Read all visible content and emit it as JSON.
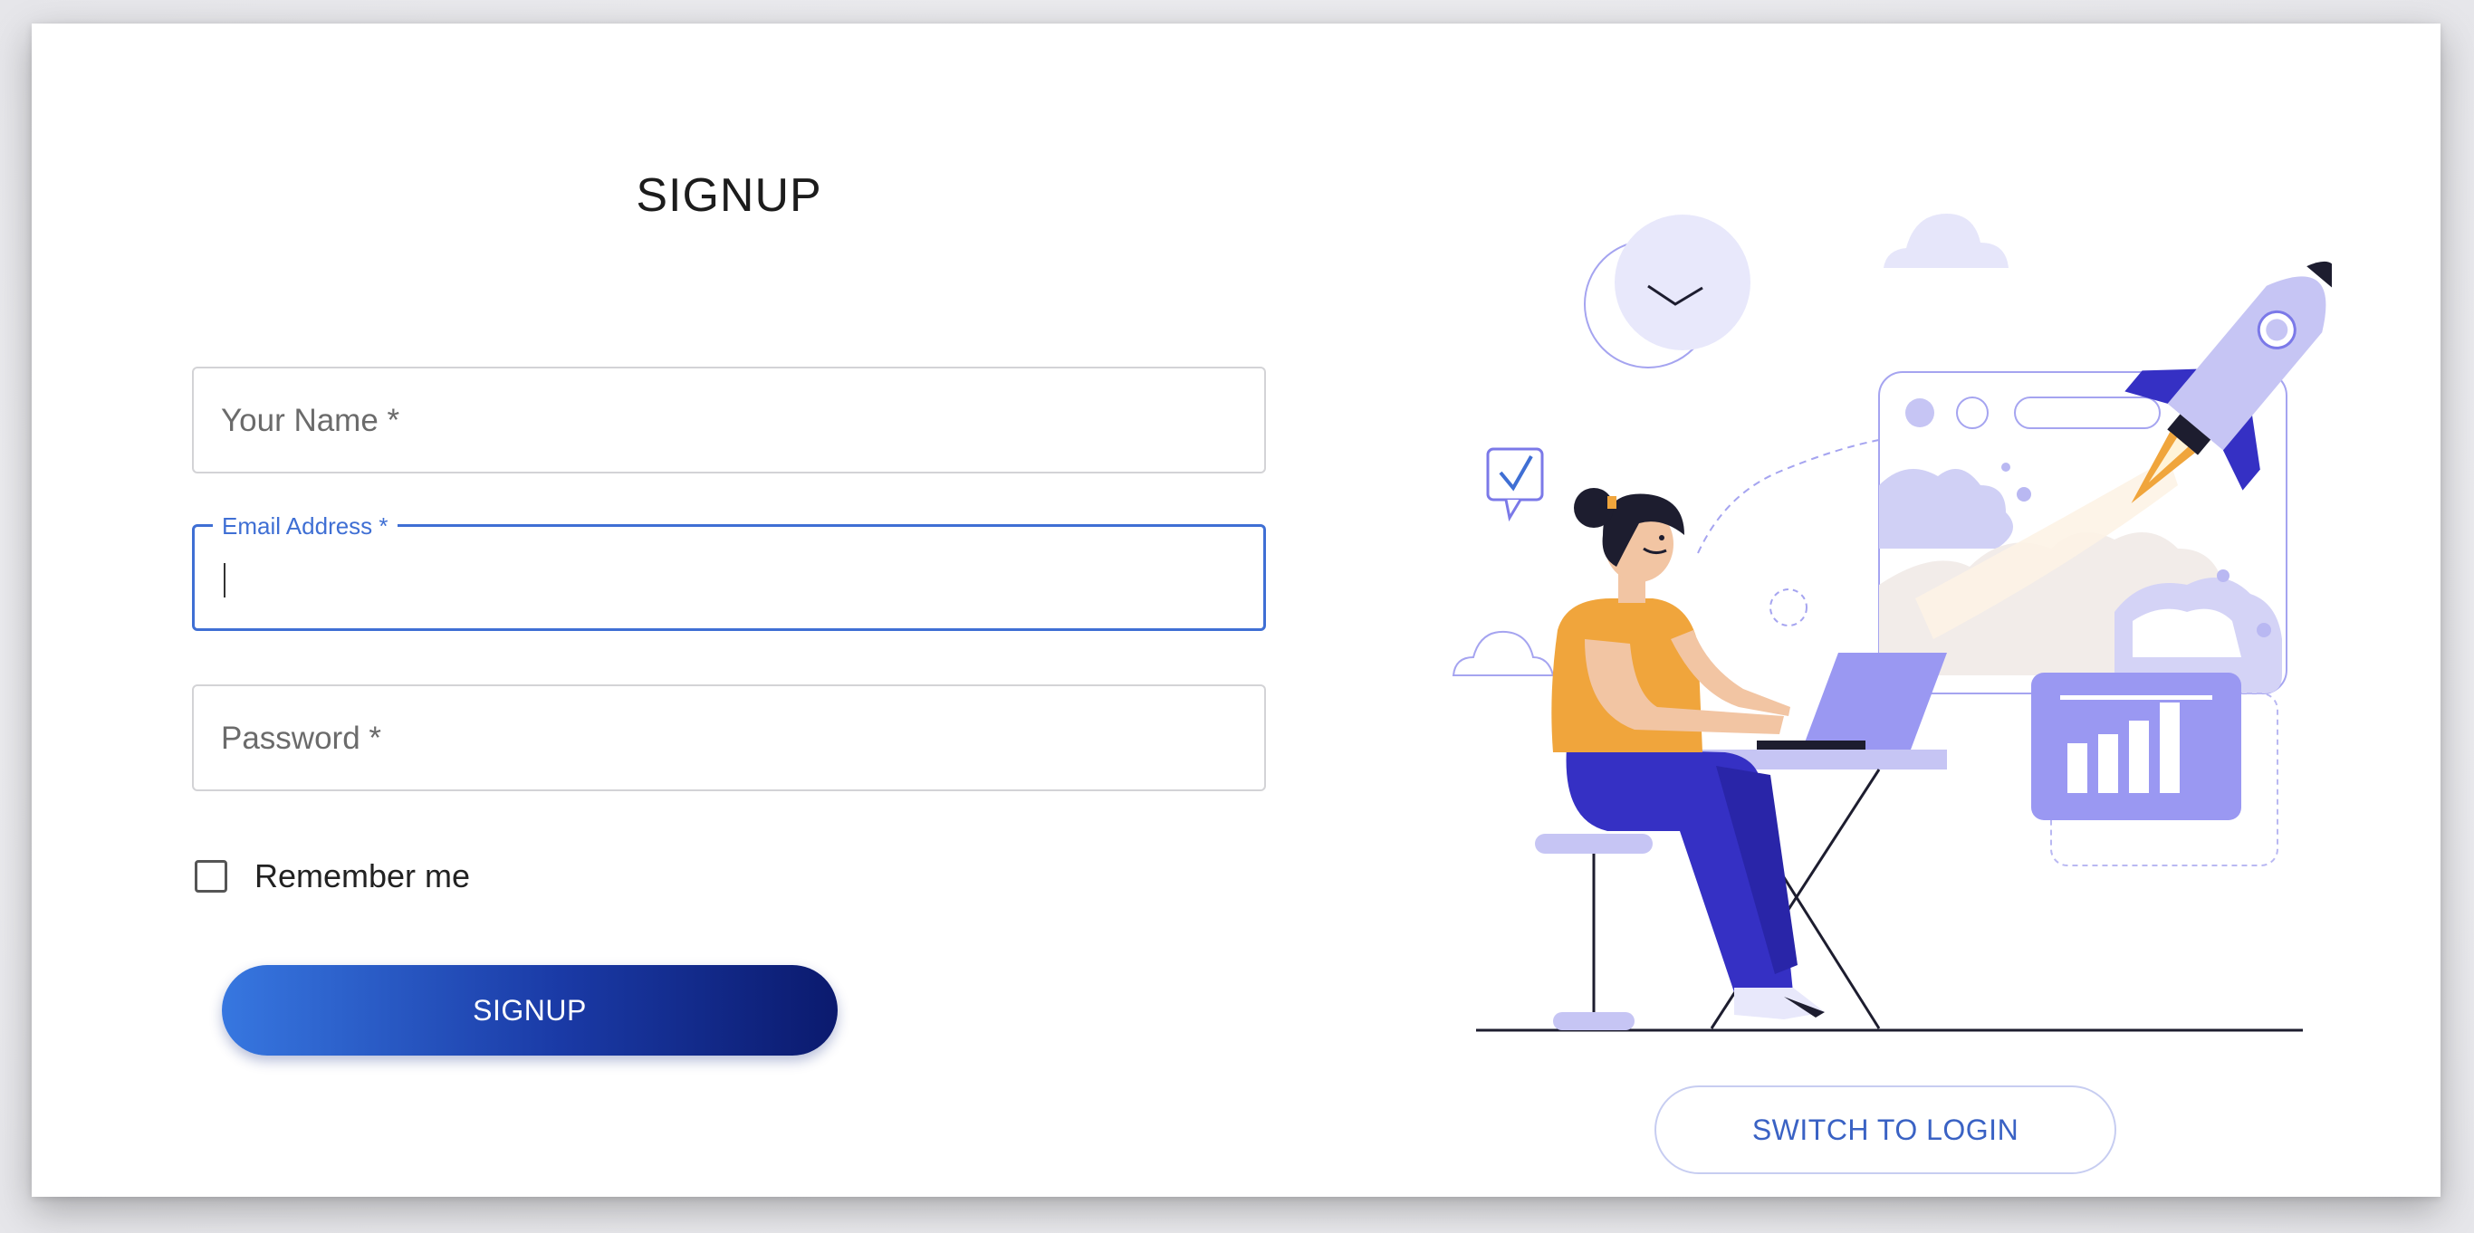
{
  "page": {
    "title": "SIGNUP"
  },
  "form": {
    "name_placeholder": "Your Name *",
    "email_label": "Email Address *",
    "password_placeholder": "Password *",
    "remember_label": "Remember me",
    "remember_checked": false,
    "submit_label": "SIGNUP"
  },
  "switch": {
    "label": "SWITCH TO LOGIN"
  },
  "colors": {
    "accent": "#3f6fd4",
    "button_gradient_start": "#3777e0",
    "button_gradient_end": "#0b1a6e",
    "illustration_lavender": "#9a98f2",
    "illustration_blue": "#3530c4",
    "illustration_orange": "#f0a53c"
  },
  "illustration": {
    "subject": "woman-working-on-laptop-with-rocket-launch",
    "icons": [
      "clock-icon",
      "checkmark-icon",
      "cloud-icon",
      "rocket-icon",
      "browser-window-icon",
      "bar-chart-icon"
    ]
  }
}
